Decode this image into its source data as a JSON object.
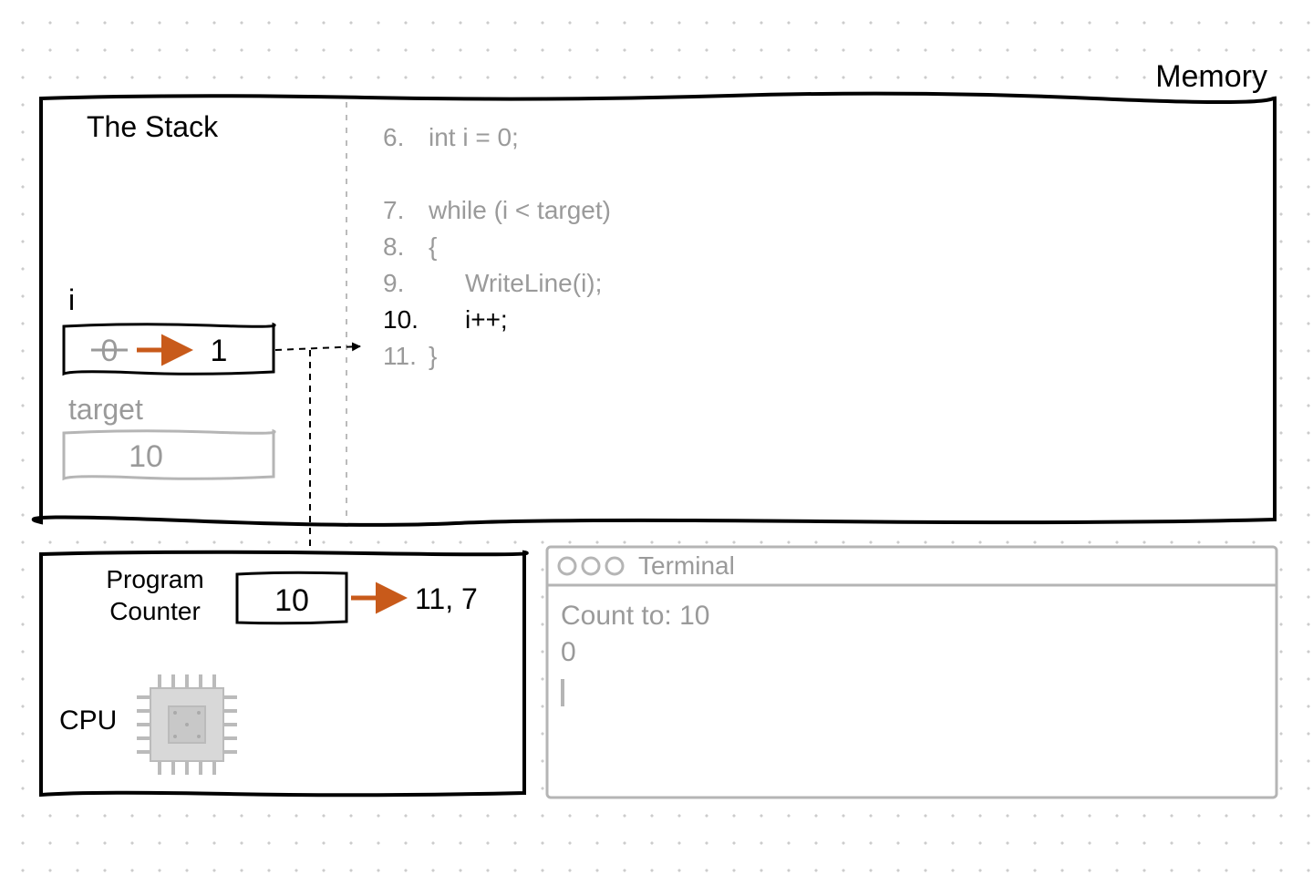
{
  "memory_label": "Memory",
  "stack_label": "The Stack",
  "vars": {
    "i": {
      "name": "i",
      "old": "0",
      "new": "1"
    },
    "target": {
      "name": "target",
      "value": "10"
    }
  },
  "code": [
    {
      "n": "6.",
      "text": "int i = 0;",
      "active": false,
      "indent": 0
    },
    {
      "n": "",
      "text": "",
      "active": false,
      "indent": 0
    },
    {
      "n": "7.",
      "text": "while (i < target)",
      "active": false,
      "indent": 0
    },
    {
      "n": "8.",
      "text": "{",
      "active": false,
      "indent": 0
    },
    {
      "n": "9.",
      "text": "WriteLine(i);",
      "active": false,
      "indent": 1
    },
    {
      "n": "10.",
      "text": "i++;",
      "active": true,
      "indent": 1
    },
    {
      "n": "11.",
      "text": "}",
      "active": false,
      "indent": 0
    }
  ],
  "pc": {
    "label_l1": "Program",
    "label_l2": "Counter",
    "value": "10",
    "next": "11, 7"
  },
  "cpu_label": "CPU",
  "terminal": {
    "title": "Terminal",
    "lines": [
      "Count to: 10",
      "0"
    ]
  }
}
